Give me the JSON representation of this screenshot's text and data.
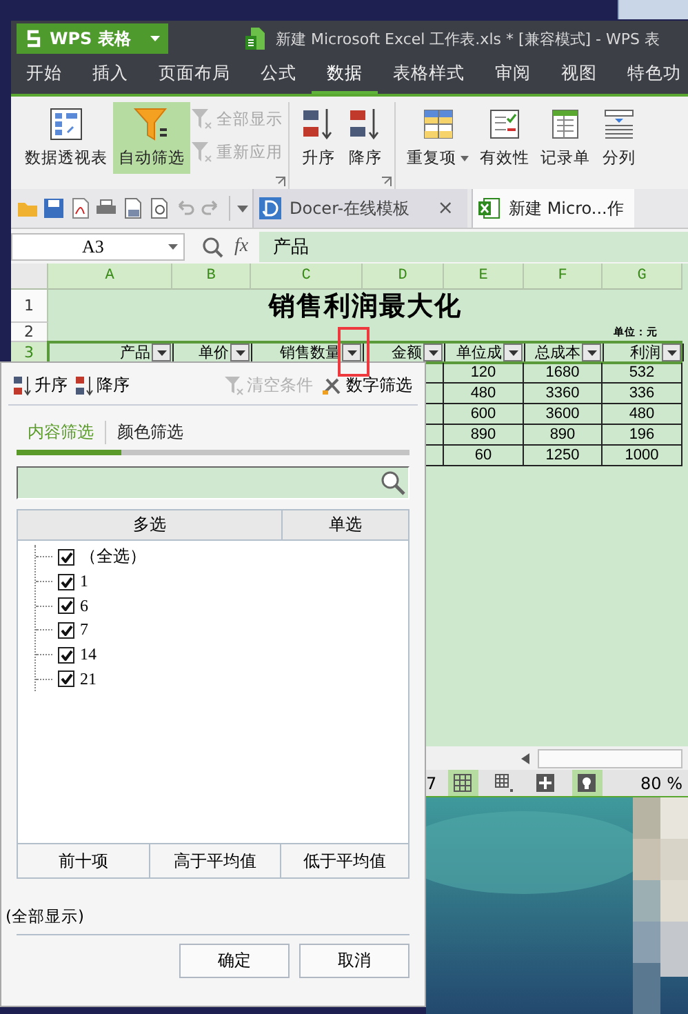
{
  "window": {
    "app_button": "WPS 表格",
    "title": "新建 Microsoft Excel 工作表.xls * [兼容模式] - WPS 表"
  },
  "menu_tabs": [
    {
      "label": "开始",
      "selected": false
    },
    {
      "label": "插入",
      "selected": false
    },
    {
      "label": "页面布局",
      "selected": false
    },
    {
      "label": "公式",
      "selected": false
    },
    {
      "label": "数据",
      "selected": true
    },
    {
      "label": "表格样式",
      "selected": false
    },
    {
      "label": "审阅",
      "selected": false
    },
    {
      "label": "视图",
      "selected": false
    },
    {
      "label": "特色功",
      "selected": false
    }
  ],
  "ribbon": {
    "groups": [
      {
        "launcher": true,
        "items": [
          {
            "kind": "large",
            "label": "数据透视表",
            "on": false,
            "disabled": false
          },
          {
            "kind": "large",
            "label": "自动筛选",
            "on": true,
            "disabled": false
          },
          {
            "kind": "small",
            "label": "全部显示",
            "on": false,
            "disabled": true
          },
          {
            "kind": "small",
            "label": "重新应用",
            "on": false,
            "disabled": true
          }
        ]
      },
      {
        "launcher": true,
        "items": [
          {
            "kind": "large",
            "label": "升序",
            "on": false,
            "disabled": false
          },
          {
            "kind": "large",
            "label": "降序",
            "on": false,
            "disabled": false
          }
        ]
      },
      {
        "launcher": false,
        "items": [
          {
            "kind": "large",
            "label": "重复项",
            "on": false,
            "disabled": false,
            "menu": true
          },
          {
            "kind": "large",
            "label": "有效性",
            "on": false,
            "disabled": false,
            "menu": false
          },
          {
            "kind": "large",
            "label": "记录单",
            "on": false,
            "disabled": false,
            "menu": false
          },
          {
            "kind": "large",
            "label": "分列",
            "on": false,
            "disabled": false,
            "menu": false
          }
        ]
      }
    ]
  },
  "doc_tabs": [
    {
      "label": "Docer-在线模板",
      "selected": false,
      "close": "×"
    },
    {
      "label": "新建 Micro...作",
      "selected": true
    }
  ],
  "formula_bar": {
    "cell_ref": "A3",
    "fx": "fx",
    "content": "产品"
  },
  "sheet": {
    "columns": [
      {
        "label": "A",
        "selected": true
      },
      {
        "label": "B",
        "selected": true
      },
      {
        "label": "C",
        "selected": true
      },
      {
        "label": "D",
        "selected": true
      },
      {
        "label": "E",
        "selected": true
      },
      {
        "label": "F",
        "selected": true
      },
      {
        "label": "G",
        "selected": true
      }
    ],
    "row_headers": [
      {
        "label": "1",
        "selected": false
      },
      {
        "label": "2",
        "selected": false
      },
      {
        "label": "3",
        "selected": true
      }
    ],
    "title": "销售利润最大化",
    "unit": "单位：元",
    "header_cells": [
      {
        "text": "产品",
        "filter": true
      },
      {
        "text": "单价",
        "filter": true
      },
      {
        "text": "销售数量",
        "filter": true
      },
      {
        "text": "金额",
        "filter": true
      },
      {
        "text": "单位成",
        "filter": true
      },
      {
        "text": "总成本",
        "filter": true
      },
      {
        "text": "利润",
        "filter": true
      }
    ],
    "rows": [
      {
        "column_5": "120",
        "column_6": "1680",
        "column_7": "532"
      },
      {
        "column_5": "480",
        "column_6": "3360",
        "column_7": "336"
      },
      {
        "column_5": "600",
        "column_6": "3600",
        "column_7": "480"
      },
      {
        "column_5": "890",
        "column_6": "890",
        "column_7": "196"
      },
      {
        "column_5": "60",
        "column_6": "1250",
        "column_7": "1000"
      }
    ]
  },
  "status_bar": {
    "page": "7",
    "zoom": "80 %"
  },
  "filter_popup": {
    "actions": [
      {
        "label": "升序",
        "disabled": false
      },
      {
        "label": "降序",
        "disabled": false
      },
      {
        "label": "清空条件",
        "disabled": true
      },
      {
        "label": "数字筛选",
        "disabled": false
      }
    ],
    "tabs": [
      {
        "label": "内容筛选",
        "selected": true
      },
      {
        "label": "颜色筛选",
        "selected": false
      }
    ],
    "list_columns": [
      "多选",
      "单选"
    ],
    "items": [
      {
        "label": "（全选）",
        "checked": true
      },
      {
        "label": "1",
        "checked": true
      },
      {
        "label": "6",
        "checked": true
      },
      {
        "label": "7",
        "checked": true
      },
      {
        "label": "14",
        "checked": true
      },
      {
        "label": "21",
        "checked": true
      }
    ],
    "quick_filters": [
      "前十项",
      "高于平均值",
      "低于平均值"
    ],
    "status": "(全部显示)",
    "buttons": [
      "确定",
      "取消"
    ]
  }
}
